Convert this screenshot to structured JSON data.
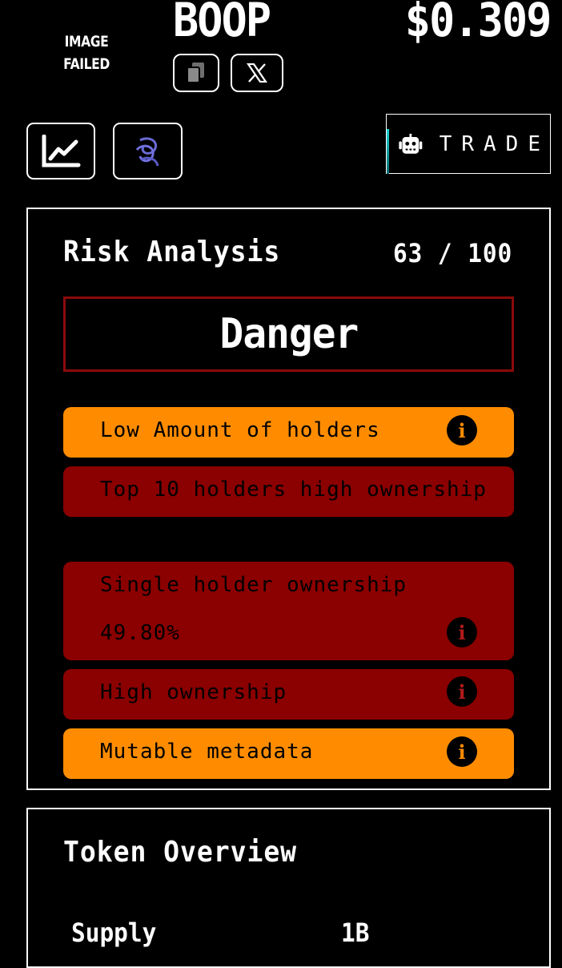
{
  "header": {
    "image_failed_line1": "IMAGE",
    "image_failed_line2": "FAILED",
    "ticker": "BOOP",
    "price": "$0.309"
  },
  "actions": {
    "copy_icon": "copy-icon",
    "x_icon": "x-logo-icon",
    "chart_icon": "chart-line-icon",
    "swirl_icon": "swirl-logo-icon",
    "trade_icon": "robot-icon",
    "trade_label": "TRADE"
  },
  "risk_analysis": {
    "title": "Risk Analysis",
    "score": "63 / 100",
    "status": "Danger",
    "items": [
      {
        "label": "Low Amount of holders",
        "level": "warning",
        "info": "i"
      },
      {
        "label": "Top 10 holders high ownership",
        "level": "danger"
      },
      {
        "label": "Single holder ownership",
        "value": "49.80%",
        "level": "danger",
        "info": "i"
      },
      {
        "label": "High ownership",
        "level": "danger",
        "info": "i"
      },
      {
        "label": "Mutable metadata",
        "level": "warning",
        "info": "i"
      }
    ]
  },
  "token_overview": {
    "title": "Token Overview",
    "rows": [
      {
        "label": "Supply",
        "value": "1B"
      }
    ]
  },
  "colors": {
    "background": "#000000",
    "warning": "#ff8c00",
    "danger": "#8b0000",
    "accent": "#1ad5d5",
    "swirl": "#6b6bd6"
  }
}
